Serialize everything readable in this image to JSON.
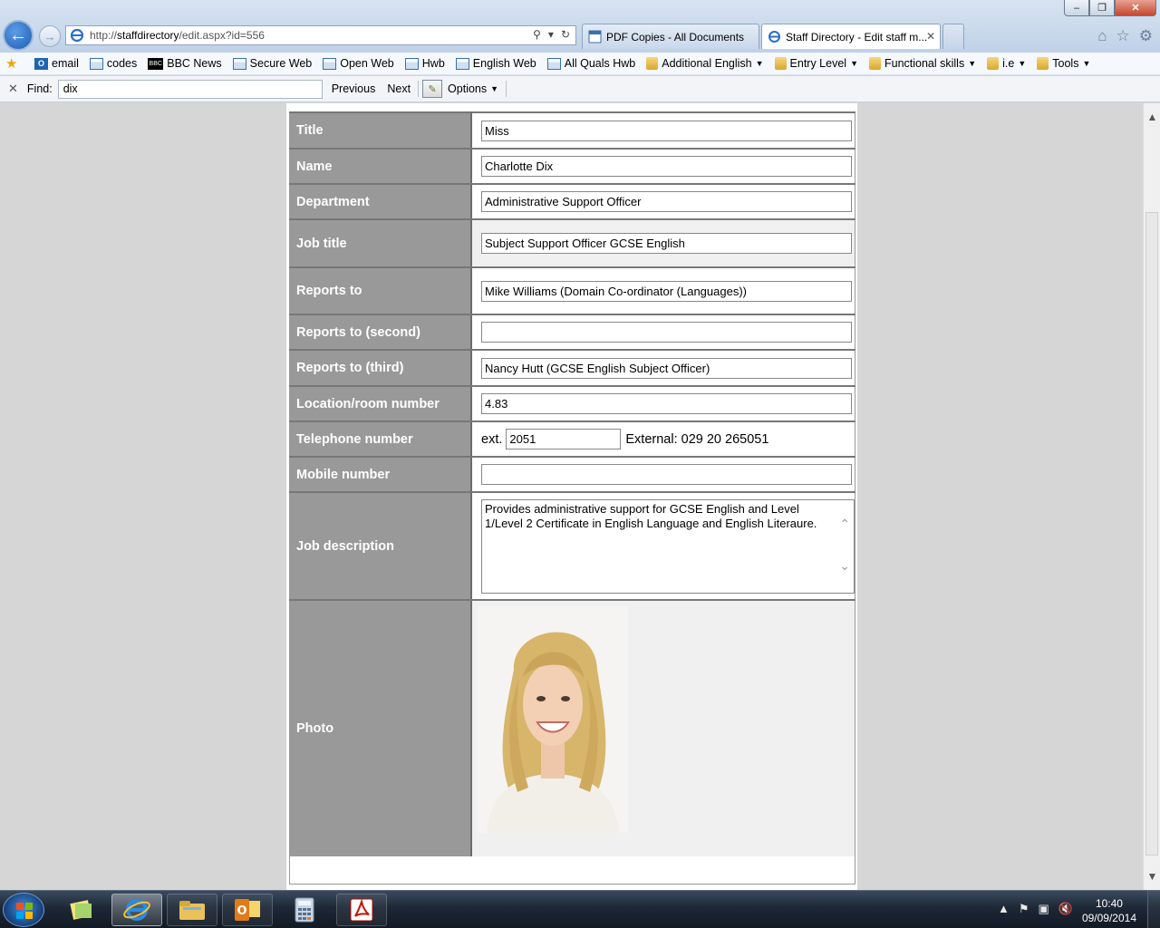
{
  "window": {
    "title": "Staff Directory - Edit staff member - Windows Internet Explorer"
  },
  "address": {
    "url_prefix": "http://",
    "url_host": "staffdirectory",
    "url_path": "/edit.aspx?id=556"
  },
  "tabs": [
    {
      "label": "PDF Copies - All Documents"
    },
    {
      "label": "Staff Directory - Edit staff m..."
    }
  ],
  "favorites": [
    {
      "label": "email",
      "icon": "outlook-icon"
    },
    {
      "label": "codes",
      "icon": "page-icon"
    },
    {
      "label": "BBC News",
      "icon": "bbc-icon"
    },
    {
      "label": "Secure Web",
      "icon": "page-icon"
    },
    {
      "label": "Open Web",
      "icon": "page-icon"
    },
    {
      "label": "Hwb",
      "icon": "page-icon"
    },
    {
      "label": "English Web",
      "icon": "page-icon"
    },
    {
      "label": "All Quals Hwb",
      "icon": "page-icon"
    },
    {
      "label": "Additional English",
      "icon": "folder-icon"
    },
    {
      "label": "Entry Level",
      "icon": "folder-icon"
    },
    {
      "label": "Functional skills",
      "icon": "folder-icon"
    },
    {
      "label": "i.e",
      "icon": "folder-icon"
    },
    {
      "label": "Tools",
      "icon": "folder-icon"
    }
  ],
  "find": {
    "label": "Find:",
    "value": "dix",
    "previous": "Previous",
    "next": "Next",
    "options": "Options"
  },
  "form": {
    "title_label": "Title",
    "title_value": "Miss",
    "name_label": "Name",
    "name_value": "Charlotte Dix",
    "department_label": "Department",
    "department_value": "Administrative Support Officer",
    "job_title_label": "Job title",
    "job_title_value": "Subject Support Officer GCSE English",
    "reports_to_label": "Reports to",
    "reports_to_value": "Mike Williams (Domain Co-ordinator (Languages))",
    "reports_to_second_label": "Reports to (second)",
    "reports_to_second_value": "",
    "reports_to_third_label": "Reports to (third)",
    "reports_to_third_value": "Nancy Hutt (GCSE English Subject Officer)",
    "location_label": "Location/room number",
    "location_value": "4.83",
    "telephone_label": "Telephone number",
    "telephone_ext_prefix": "ext.",
    "telephone_ext_value": "2051",
    "telephone_external": "External: 029 20 265051",
    "mobile_label": "Mobile number",
    "mobile_value": "",
    "job_description_label": "Job description",
    "job_description_value": "Provides administrative support for GCSE English and Level 1/Level 2 Certificate in English Language and English Literaure.",
    "photo_label": "Photo"
  },
  "clock": {
    "time": "10:40",
    "date": "09/09/2014"
  },
  "colors": {
    "label_bg": "#999999",
    "ie_blue": "#1e5fb6",
    "taskbar": "#1d2836"
  }
}
